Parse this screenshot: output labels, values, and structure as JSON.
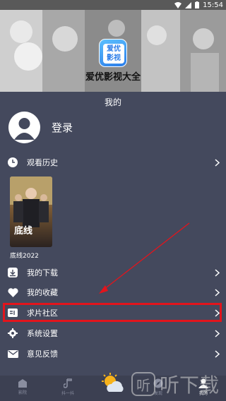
{
  "status_bar": {
    "time": "15:54"
  },
  "app": {
    "logo_text_top": "爱优",
    "logo_text_bottom": "影视",
    "name": "爱优影视大全"
  },
  "page": {
    "title": "我的"
  },
  "user": {
    "login_label": "登录"
  },
  "menu": {
    "history_label": "观看历史",
    "movie": {
      "name": "底线2022",
      "poster_text": "底线"
    },
    "downloads_label": "我的下载",
    "favorites_label": "我的收藏",
    "request_label": "求片社区",
    "settings_label": "系统设置",
    "feedback_label": "意见反馈"
  },
  "tabs": [
    {
      "label": "影院",
      "active": false
    },
    {
      "label": "抖一抖",
      "active": false
    },
    {
      "label": "",
      "active": false
    },
    {
      "label": "发现",
      "active": false
    },
    {
      "label": "我的",
      "active": true
    }
  ],
  "watermark": {
    "icon_text": "听",
    "text": "听下载"
  },
  "colors": {
    "background": "#44495d",
    "highlight": "#e3141c",
    "accent": "#2b7de9"
  }
}
